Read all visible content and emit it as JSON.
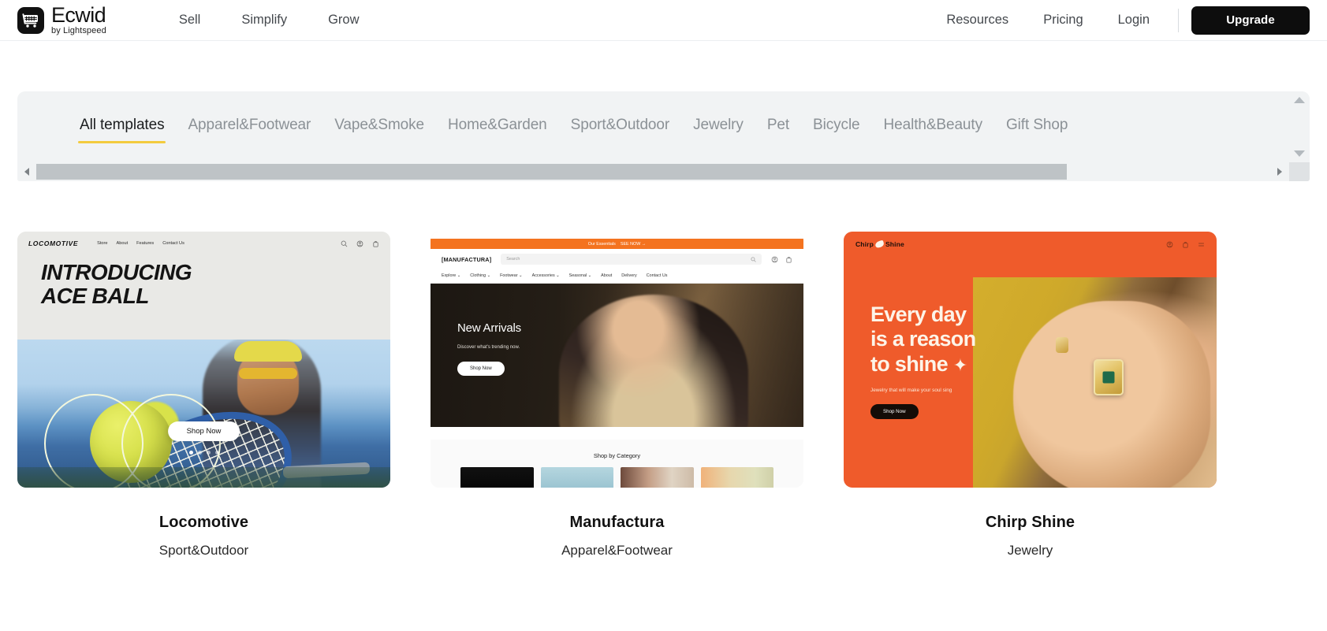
{
  "header": {
    "brand": {
      "name": "Ecwid",
      "tagline": "by Lightspeed",
      "logo_icon": "shopping-cart-icon"
    },
    "nav": [
      {
        "label": "Sell"
      },
      {
        "label": "Simplify"
      },
      {
        "label": "Grow"
      }
    ],
    "right_nav": [
      {
        "label": "Resources"
      },
      {
        "label": "Pricing"
      },
      {
        "label": "Login"
      }
    ],
    "upgrade_label": "Upgrade",
    "accent_color": "#0d0d0d"
  },
  "tabs": {
    "active_index": 0,
    "underline_color": "#f3cb3e",
    "items": [
      {
        "label": "All templates"
      },
      {
        "label": "Apparel&Footwear"
      },
      {
        "label": "Vape&Smoke"
      },
      {
        "label": "Home&Garden"
      },
      {
        "label": "Sport&Outdoor"
      },
      {
        "label": "Jewelry"
      },
      {
        "label": "Pet"
      },
      {
        "label": "Bicycle"
      },
      {
        "label": "Health&Beauty"
      },
      {
        "label": "Gift Shop"
      }
    ],
    "scroll": {
      "horizontal_thumb_percent": 83.5,
      "up_arrow_icon": "triangle-up-icon",
      "down_arrow_icon": "triangle-down-icon",
      "left_arrow_icon": "triangle-left-icon",
      "right_arrow_icon": "triangle-right-icon"
    }
  },
  "cards": [
    {
      "title": "Locomotive",
      "category": "Sport&Outdoor",
      "preview": {
        "logo": "LOCOMOTIVE",
        "nav": [
          "Store",
          "About",
          "Features",
          "Contact Us"
        ],
        "icons": [
          "search-icon",
          "account-icon",
          "cart-icon"
        ],
        "headline_line1": "INTRODUCING",
        "headline_line2": "ACE BALL",
        "cta": "Shop Now"
      }
    },
    {
      "title": "Manufactura",
      "category": "Apparel&Footwear",
      "preview": {
        "banner": "Our Essentials",
        "banner_cta": "SEE NOW →",
        "logo": "[MANUFACTURA]",
        "search_placeholder": "Search",
        "icons": [
          "search-icon",
          "account-icon",
          "cart-icon"
        ],
        "nav": [
          "Explore ⌄",
          "Clothing ⌄",
          "Footwear ⌄",
          "Accessories ⌄",
          "Seasonal ⌄",
          "About",
          "Delivery",
          "Contact Us"
        ],
        "hero_title": "New Arrivals",
        "hero_sub": "Discover what's trending now.",
        "cta": "Shop Now",
        "section_title": "Shop by Category"
      }
    },
    {
      "title": "Chirp Shine",
      "category": "Jewelry",
      "preview": {
        "logo_part1": "Chirp",
        "logo_part2": "Shine",
        "logo_icon": "bird-icon",
        "icons": [
          "account-icon",
          "cart-icon",
          "menu-icon"
        ],
        "headline_line1": "Every day",
        "headline_line2": "is a reason",
        "headline_line3": "to shine",
        "headline_star": "✦",
        "sub": "Jewelry that will make your soul sing",
        "cta": "Shop Now",
        "brand_color": "#ef5b2b"
      }
    }
  ]
}
